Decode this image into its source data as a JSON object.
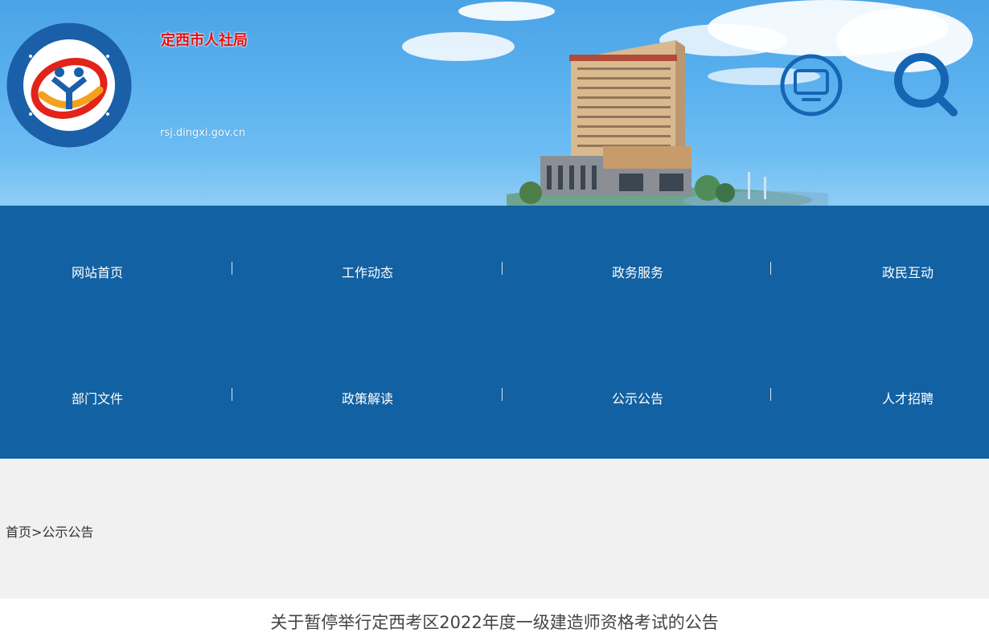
{
  "header": {
    "site_title": "定西市人社局",
    "site_url": "rsj.dingxi.gov.cn",
    "logo_icon": "dingxi-hrss-emblem",
    "monitor_icon": "monitor-icon",
    "search_icon": "search-icon",
    "colors": {
      "sky": "#5cb2ef",
      "title_red": "#e60f0f"
    }
  },
  "nav": {
    "row1": [
      "网站首页",
      "工作动态",
      "政务服务",
      "政民互动"
    ],
    "row2": [
      "部门文件",
      "政策解读",
      "公示公告",
      "人才招聘"
    ],
    "colors": {
      "background": "#1261a2",
      "text": "#ffffff"
    }
  },
  "breadcrumb": {
    "home": "首页",
    "separator": ">",
    "current": "公示公告"
  },
  "article": {
    "title": "关于暂停举行定西考区2022年度一级建造师资格考试的公告"
  }
}
